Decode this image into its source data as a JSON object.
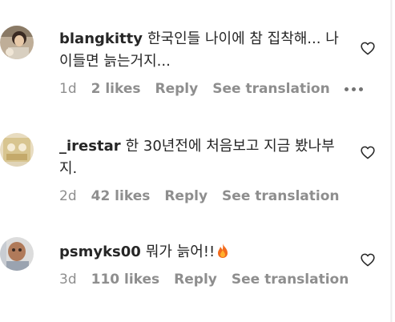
{
  "comments": [
    {
      "username": "blangkitty",
      "text": "한국인들 나이에 참 집착해... 나이들면 늙는거지...",
      "time_ago": "1d",
      "likes": "2 likes",
      "reply": "Reply",
      "translate": "See translation",
      "more_icon": "more-dots-icon",
      "avatar_icon": "avatar-photo"
    },
    {
      "username": "_irestar",
      "text": "한 30년전에 처음보고 지금 봤나부지.",
      "time_ago": "2d",
      "likes": "42 likes",
      "reply": "Reply",
      "translate": "See translation",
      "avatar_icon": "avatar-photo"
    },
    {
      "username": "psmyks00",
      "text": "뭐가 늙어!!",
      "emoji": "fire-emoji",
      "time_ago": "3d",
      "likes": "110 likes",
      "reply": "Reply",
      "translate": "See translation",
      "avatar_icon": "avatar-photo"
    }
  ],
  "colors": {
    "text": "#262626",
    "meta": "#8e8e8e"
  }
}
